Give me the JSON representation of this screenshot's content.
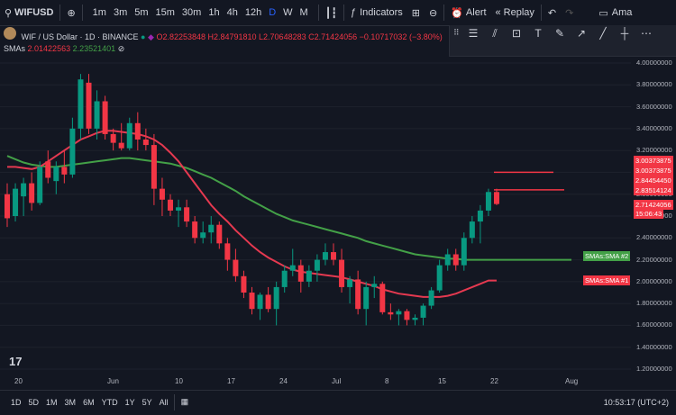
{
  "header": {
    "symbol": "WIFUSD",
    "intervals": [
      "1m",
      "3m",
      "5m",
      "15m",
      "30m",
      "1h",
      "4h",
      "12h",
      "D",
      "W",
      "M"
    ],
    "active_interval": "D",
    "indicators_label": "Indicators",
    "alert_label": "Alert",
    "replay_label": "Replay",
    "account_label": "Ama"
  },
  "legend": {
    "title": "WIF / US Dollar · 1D · BINANCE",
    "ohlc": "O2.82253848 H2.84791810 L2.70648283 C2.71424056 −0.10717032 (−3.80%)",
    "smas_label": "SMAs",
    "sma1": "2.01422563",
    "sma2": "2.23521401"
  },
  "price_axis": {
    "ticks": [
      "4.00000000",
      "3.80000000",
      "3.60000000",
      "3.40000000",
      "3.20000000",
      "3.00000000",
      "2.80000000",
      "2.60000000",
      "2.40000000",
      "2.20000000",
      "2.00000000",
      "1.80000000",
      "1.60000000",
      "1.40000000",
      "1.20000000"
    ]
  },
  "price_labels": {
    "p1": "3.00373875",
    "p2": "3.00373875",
    "p3": "2.84454450",
    "p4": "2.83514124",
    "p5": "2.71424056",
    "countdown": "15:06:43",
    "sma2_label": "SMAs:SMA #2",
    "sma1_label": "SMAs:SMA #1"
  },
  "time_axis": [
    "20",
    "Jun",
    "10",
    "17",
    "24",
    "Jul",
    "8",
    "15",
    "22",
    "Aug"
  ],
  "footer": {
    "ranges": [
      "1D",
      "5D",
      "1M",
      "3M",
      "6M",
      "YTD",
      "1Y",
      "5Y",
      "All"
    ],
    "clock": "10:53:17 (UTC+2)"
  },
  "colors": {
    "up": "#089981",
    "down": "#f23645",
    "sma_green": "#43a047",
    "sma_red": "#e53950",
    "bg": "#131722",
    "accent": "#2962ff"
  },
  "chart_data": {
    "type": "candlestick",
    "title": "WIF / US Dollar · 1D · BINANCE",
    "ylim": [
      1.2,
      4.0
    ],
    "candles": [
      {
        "o": 2.8,
        "h": 2.9,
        "l": 2.5,
        "c": 2.58
      },
      {
        "o": 2.6,
        "h": 2.9,
        "l": 2.55,
        "c": 2.85
      },
      {
        "o": 2.78,
        "h": 2.95,
        "l": 2.6,
        "c": 2.9
      },
      {
        "o": 2.9,
        "h": 3.0,
        "l": 2.65,
        "c": 2.72
      },
      {
        "o": 2.72,
        "h": 3.1,
        "l": 2.7,
        "c": 3.05
      },
      {
        "o": 3.1,
        "h": 3.2,
        "l": 2.9,
        "c": 2.95
      },
      {
        "o": 2.92,
        "h": 3.1,
        "l": 2.8,
        "c": 3.05
      },
      {
        "o": 3.05,
        "h": 3.2,
        "l": 2.9,
        "c": 2.98
      },
      {
        "o": 2.98,
        "h": 3.5,
        "l": 2.95,
        "c": 3.4
      },
      {
        "o": 3.4,
        "h": 3.9,
        "l": 3.3,
        "c": 3.85
      },
      {
        "o": 3.82,
        "h": 3.9,
        "l": 3.35,
        "c": 3.4
      },
      {
        "o": 3.4,
        "h": 3.75,
        "l": 3.3,
        "c": 3.65
      },
      {
        "o": 3.65,
        "h": 3.7,
        "l": 3.3,
        "c": 3.35
      },
      {
        "o": 3.35,
        "h": 3.4,
        "l": 3.2,
        "c": 3.27
      },
      {
        "o": 3.27,
        "h": 3.45,
        "l": 3.2,
        "c": 3.22
      },
      {
        "o": 3.22,
        "h": 3.5,
        "l": 3.2,
        "c": 3.45
      },
      {
        "o": 3.45,
        "h": 3.55,
        "l": 3.2,
        "c": 3.3
      },
      {
        "o": 3.3,
        "h": 3.4,
        "l": 3.2,
        "c": 3.25
      },
      {
        "o": 3.25,
        "h": 3.35,
        "l": 2.7,
        "c": 2.85
      },
      {
        "o": 2.85,
        "h": 2.95,
        "l": 2.6,
        "c": 2.75
      },
      {
        "o": 2.75,
        "h": 2.8,
        "l": 2.6,
        "c": 2.65
      },
      {
        "o": 2.65,
        "h": 2.75,
        "l": 2.5,
        "c": 2.68
      },
      {
        "o": 2.68,
        "h": 2.75,
        "l": 2.5,
        "c": 2.55
      },
      {
        "o": 2.55,
        "h": 2.6,
        "l": 2.35,
        "c": 2.4
      },
      {
        "o": 2.4,
        "h": 2.55,
        "l": 2.35,
        "c": 2.45
      },
      {
        "o": 2.45,
        "h": 2.6,
        "l": 2.35,
        "c": 2.52
      },
      {
        "o": 2.52,
        "h": 2.55,
        "l": 2.3,
        "c": 2.35
      },
      {
        "o": 2.35,
        "h": 2.4,
        "l": 2.1,
        "c": 2.2
      },
      {
        "o": 2.2,
        "h": 2.3,
        "l": 2.0,
        "c": 2.05
      },
      {
        "o": 2.05,
        "h": 2.1,
        "l": 1.85,
        "c": 1.9
      },
      {
        "o": 1.9,
        "h": 1.95,
        "l": 1.7,
        "c": 1.75
      },
      {
        "o": 1.75,
        "h": 1.9,
        "l": 1.65,
        "c": 1.88
      },
      {
        "o": 1.88,
        "h": 1.95,
        "l": 1.72,
        "c": 1.75
      },
      {
        "o": 1.75,
        "h": 2.0,
        "l": 1.6,
        "c": 1.95
      },
      {
        "o": 1.95,
        "h": 2.15,
        "l": 1.9,
        "c": 2.1
      },
      {
        "o": 2.1,
        "h": 2.3,
        "l": 2.05,
        "c": 2.15
      },
      {
        "o": 2.15,
        "h": 2.2,
        "l": 1.9,
        "c": 2.0
      },
      {
        "o": 2.0,
        "h": 2.15,
        "l": 1.95,
        "c": 2.1
      },
      {
        "o": 2.1,
        "h": 2.25,
        "l": 2.0,
        "c": 2.2
      },
      {
        "o": 2.2,
        "h": 2.35,
        "l": 2.15,
        "c": 2.27
      },
      {
        "o": 2.27,
        "h": 2.35,
        "l": 2.15,
        "c": 2.2
      },
      {
        "o": 2.2,
        "h": 2.3,
        "l": 1.9,
        "c": 1.95
      },
      {
        "o": 1.95,
        "h": 2.05,
        "l": 1.8,
        "c": 2.02
      },
      {
        "o": 2.02,
        "h": 2.1,
        "l": 1.7,
        "c": 1.75
      },
      {
        "o": 1.75,
        "h": 2.0,
        "l": 1.6,
        "c": 1.95
      },
      {
        "o": 1.95,
        "h": 2.05,
        "l": 1.85,
        "c": 1.98
      },
      {
        "o": 1.98,
        "h": 2.0,
        "l": 1.7,
        "c": 1.72
      },
      {
        "o": 1.72,
        "h": 1.8,
        "l": 1.65,
        "c": 1.7
      },
      {
        "o": 1.7,
        "h": 1.75,
        "l": 1.6,
        "c": 1.73
      },
      {
        "o": 1.73,
        "h": 1.75,
        "l": 1.6,
        "c": 1.65
      },
      {
        "o": 1.65,
        "h": 1.7,
        "l": 1.6,
        "c": 1.67
      },
      {
        "o": 1.67,
        "h": 1.8,
        "l": 1.6,
        "c": 1.78
      },
      {
        "o": 1.78,
        "h": 1.95,
        "l": 1.75,
        "c": 1.92
      },
      {
        "o": 1.92,
        "h": 2.2,
        "l": 1.9,
        "c": 2.15
      },
      {
        "o": 2.15,
        "h": 2.3,
        "l": 2.1,
        "c": 2.25
      },
      {
        "o": 2.25,
        "h": 2.3,
        "l": 2.1,
        "c": 2.15
      },
      {
        "o": 2.15,
        "h": 2.45,
        "l": 2.1,
        "c": 2.4
      },
      {
        "o": 2.4,
        "h": 2.6,
        "l": 2.35,
        "c": 2.55
      },
      {
        "o": 2.55,
        "h": 2.7,
        "l": 2.35,
        "c": 2.65
      },
      {
        "o": 2.65,
        "h": 2.85,
        "l": 2.6,
        "c": 2.82
      },
      {
        "o": 2.82,
        "h": 2.85,
        "l": 2.7,
        "c": 2.71
      }
    ],
    "sma_green": [
      3.15,
      3.12,
      3.09,
      3.07,
      3.06,
      3.05,
      3.05,
      3.06,
      3.07,
      3.08,
      3.09,
      3.1,
      3.11,
      3.12,
      3.13,
      3.13,
      3.12,
      3.11,
      3.1,
      3.09,
      3.08,
      3.06,
      3.04,
      3.01,
      2.98,
      2.95,
      2.91,
      2.87,
      2.83,
      2.78,
      2.74,
      2.7,
      2.66,
      2.62,
      2.59,
      2.56,
      2.54,
      2.52,
      2.5,
      2.48,
      2.46,
      2.44,
      2.42,
      2.4,
      2.37,
      2.35,
      2.33,
      2.31,
      2.29,
      2.27,
      2.25,
      2.24,
      2.23,
      2.22,
      2.21,
      2.21,
      2.2,
      2.2,
      2.2,
      2.2,
      2.2
    ],
    "sma_red": [
      3.05,
      3.05,
      3.04,
      3.03,
      3.05,
      3.1,
      3.15,
      3.2,
      3.25,
      3.3,
      3.33,
      3.36,
      3.38,
      3.38,
      3.37,
      3.36,
      3.35,
      3.33,
      3.3,
      3.25,
      3.18,
      3.1,
      3.0,
      2.9,
      2.8,
      2.7,
      2.62,
      2.55,
      2.47,
      2.4,
      2.33,
      2.27,
      2.22,
      2.18,
      2.14,
      2.11,
      2.09,
      2.08,
      2.07,
      2.06,
      2.05,
      2.04,
      2.02,
      2.0,
      1.98,
      1.96,
      1.93,
      1.91,
      1.89,
      1.88,
      1.87,
      1.86,
      1.86,
      1.86,
      1.87,
      1.89,
      1.92,
      1.95,
      1.98,
      2.01,
      2.01
    ]
  }
}
